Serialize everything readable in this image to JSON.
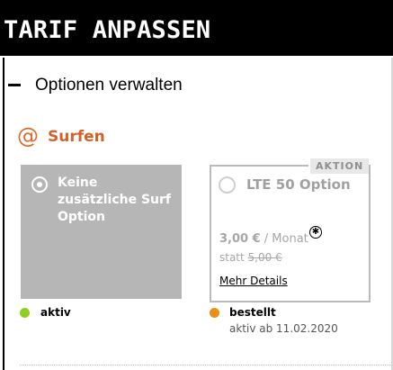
{
  "header": {
    "title": "TARIF ANPASSEN"
  },
  "section": {
    "title": "Optionen verwalten",
    "toggle_icon": "minus-icon"
  },
  "category": {
    "icon": "at-sign-icon",
    "icon_glyph": "@",
    "label": "Surfen",
    "accent_color": "#d2612a"
  },
  "options": [
    {
      "title": "Keine zusätzliche Surf Option",
      "selected": true,
      "status_label": "aktiv",
      "status_color": "#8fcf21"
    },
    {
      "badge": "AKTION",
      "title": "LTE 50 Option",
      "selected": false,
      "price": "3,00 €",
      "price_unit": " / Monat",
      "statt_label": "statt ",
      "old_price": "5,00 €",
      "footnote_glyph": "✱",
      "details_link": "Mehr Details",
      "status_label": "bestellt",
      "status_color": "#e99016",
      "status_date": "aktiv ab 11.02.2020"
    }
  ]
}
